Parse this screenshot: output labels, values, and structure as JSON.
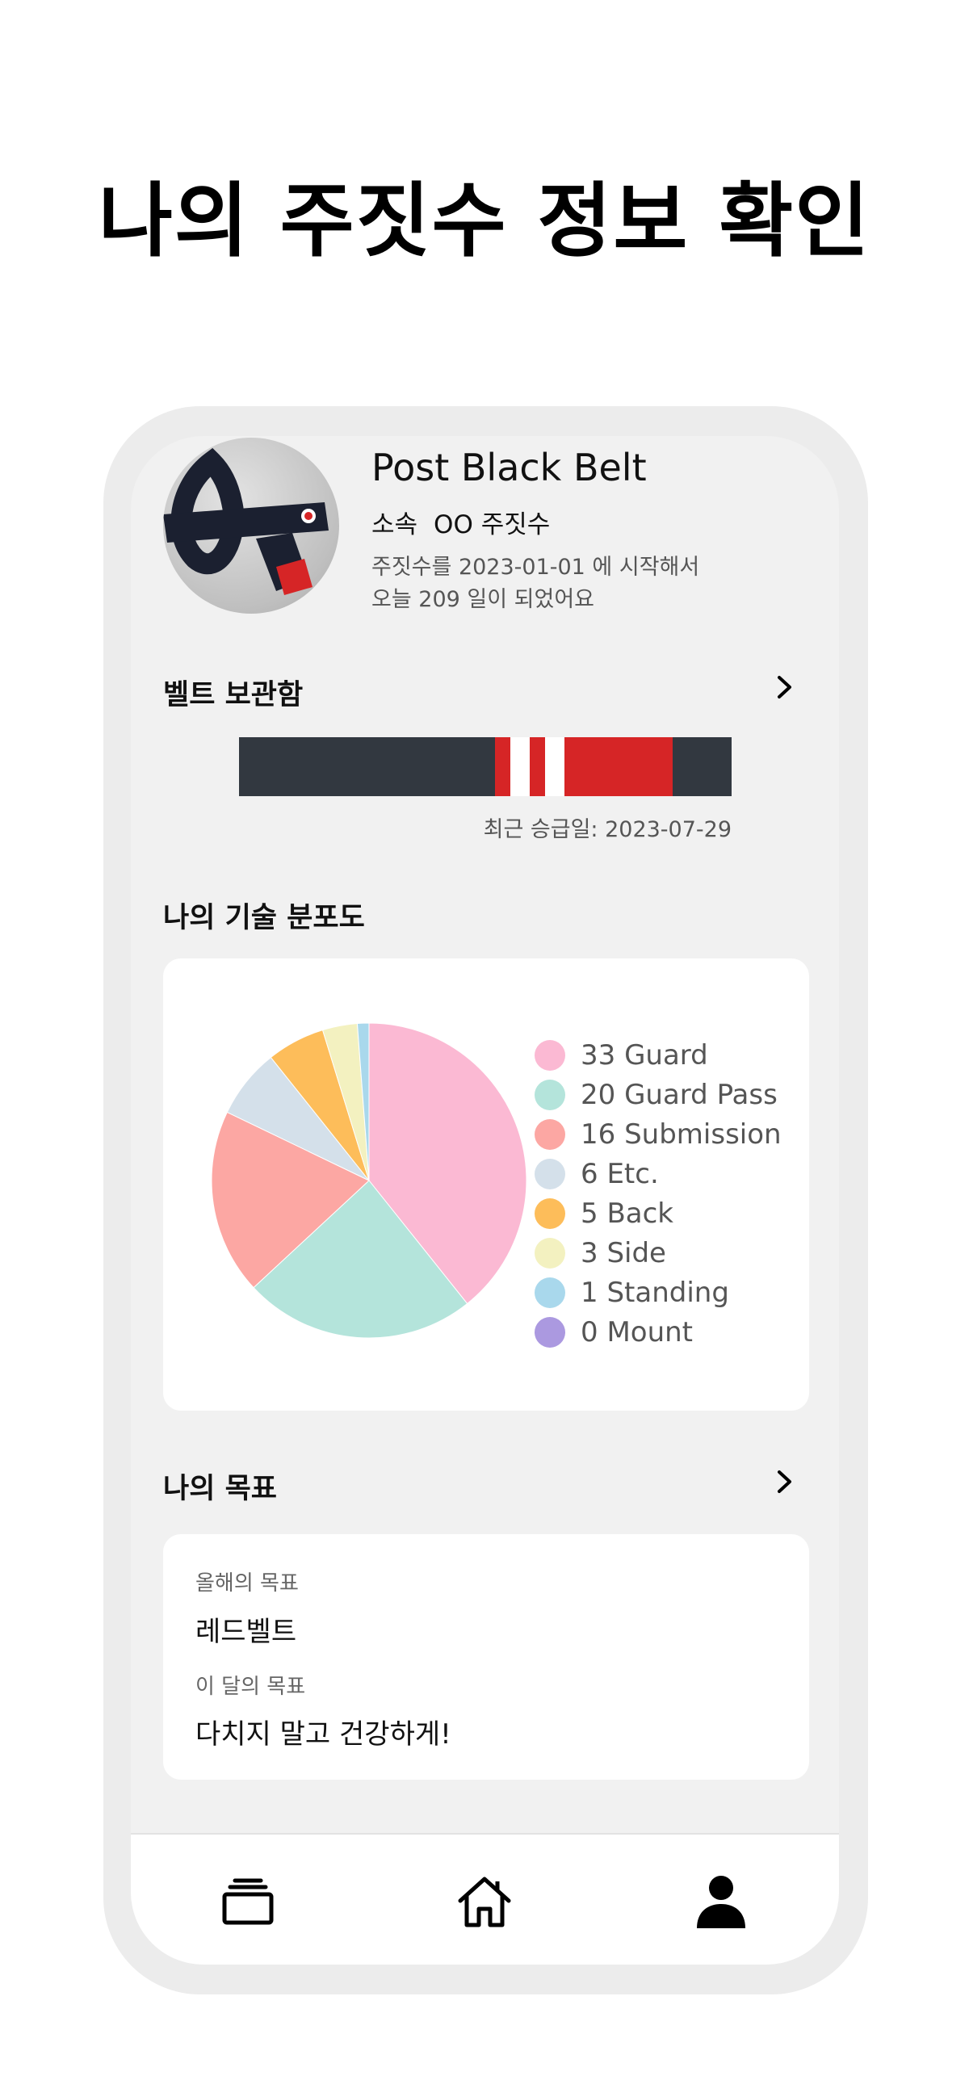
{
  "headline": "나의 주짓수 정보 확인",
  "profile": {
    "belt_title": "Post Black Belt",
    "affiliation_label": "소속",
    "affiliation_value": "OO 주짓수",
    "start_line": "주짓수를 2023-01-01 에 시작해서",
    "days_line": "오늘 209 일이 되었어요"
  },
  "belt_box": {
    "title": "벨트 보관함",
    "latest_promotion": "최근 승급일: 2023-07-29",
    "colors": {
      "belt": "#323840",
      "red": "#d62526",
      "white": "#ffffff"
    }
  },
  "technique": {
    "title": "나의 기술 분포도"
  },
  "chart_data": {
    "type": "pie",
    "slices": [
      {
        "label": "33 Guard",
        "value": 33,
        "color": "#fbb9d3"
      },
      {
        "label": "20 Guard Pass",
        "value": 20,
        "color": "#b4e4db"
      },
      {
        "label": "16 Submission",
        "value": 16,
        "color": "#fca7a3"
      },
      {
        "label": "6 Etc.",
        "value": 6,
        "color": "#d4e0ea"
      },
      {
        "label": "5 Back",
        "value": 5,
        "color": "#fdbd5a"
      },
      {
        "label": "3 Side",
        "value": 3,
        "color": "#f3f1c0"
      },
      {
        "label": "1 Standing",
        "value": 1,
        "color": "#a9d8ec"
      },
      {
        "label": "0 Mount",
        "value": 0,
        "color": "#ab99e0"
      }
    ],
    "legend_placement": "right"
  },
  "goals": {
    "title": "나의 목표",
    "year_label": "올해의 목표",
    "year_value": "레드벨트",
    "month_label": "이 달의 목표",
    "month_value": "다치지 말고 건강하게!"
  },
  "tabbar": {
    "icons": [
      "cards-icon",
      "home-icon",
      "profile-icon"
    ]
  }
}
